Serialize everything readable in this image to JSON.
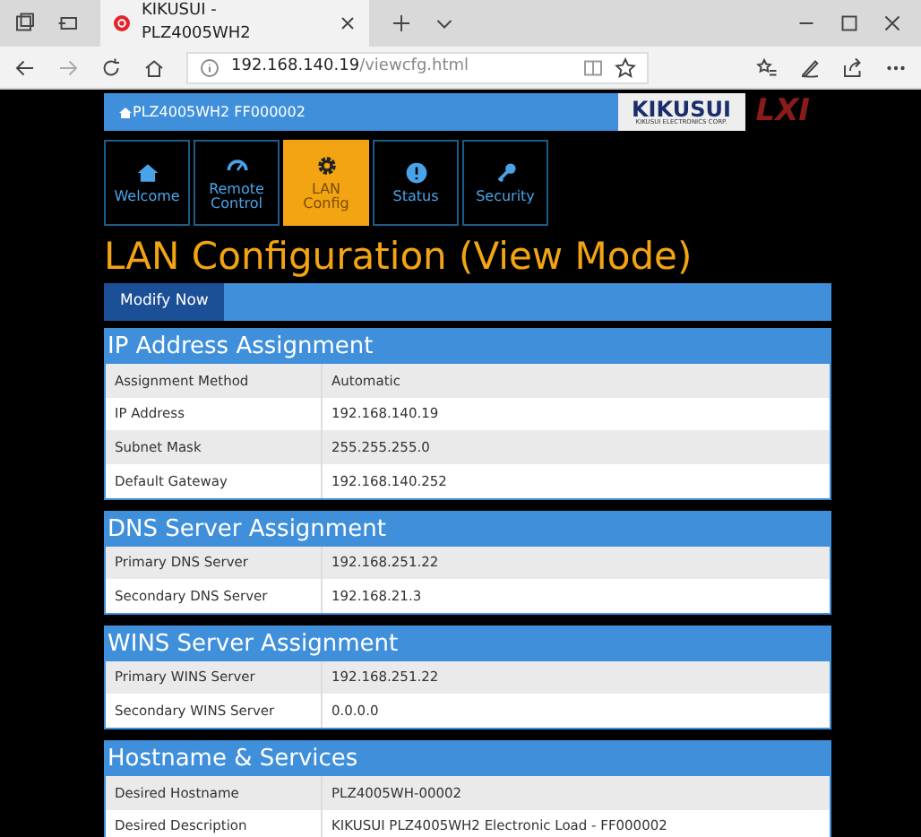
{
  "browser": {
    "tab_title": "KIKUSUI - PLZ4005WH2",
    "url_host": "192.168.140.19",
    "url_path": "/viewcfg.html"
  },
  "header": {
    "device": "PLZ4005WH2 FF000002",
    "logo_name": "KIKUSUI",
    "logo_sub": "KIKUSUI ELECTRONICS CORP.",
    "lxi": "LXI"
  },
  "nav": [
    {
      "label": "Welcome",
      "kind": "home",
      "selected": false
    },
    {
      "label": "Remote Control",
      "kind": "gauge",
      "selected": false
    },
    {
      "label": "LAN Config",
      "kind": "gear",
      "selected": true
    },
    {
      "label": "Status",
      "kind": "info",
      "selected": false
    },
    {
      "label": "Security",
      "kind": "key",
      "selected": false
    }
  ],
  "page_title": "LAN Configuration (View Mode)",
  "modify_button": "Modify Now",
  "sections": [
    {
      "title": "IP Address Assignment",
      "rows": [
        {
          "label": "Assignment Method",
          "value": "Automatic"
        },
        {
          "label": "IP Address",
          "value": "192.168.140.19"
        },
        {
          "label": "Subnet Mask",
          "value": "255.255.255.0"
        },
        {
          "label": "Default Gateway",
          "value": "192.168.140.252"
        }
      ]
    },
    {
      "title": "DNS Server Assignment",
      "rows": [
        {
          "label": "Primary DNS Server",
          "value": "192.168.251.22"
        },
        {
          "label": "Secondary DNS Server",
          "value": "192.168.21.3"
        }
      ]
    },
    {
      "title": "WINS Server Assignment",
      "rows": [
        {
          "label": "Primary WINS Server",
          "value": "192.168.251.22"
        },
        {
          "label": "Secondary WINS Server",
          "value": "0.0.0.0"
        }
      ]
    },
    {
      "title": "Hostname & Services",
      "rows": [
        {
          "label": "Desired Hostname",
          "value": "PLZ4005WH-00002"
        },
        {
          "label": "Desired Description",
          "value": "KIKUSUI PLZ4005WH2 Electronic Load - FF000002"
        }
      ]
    }
  ]
}
